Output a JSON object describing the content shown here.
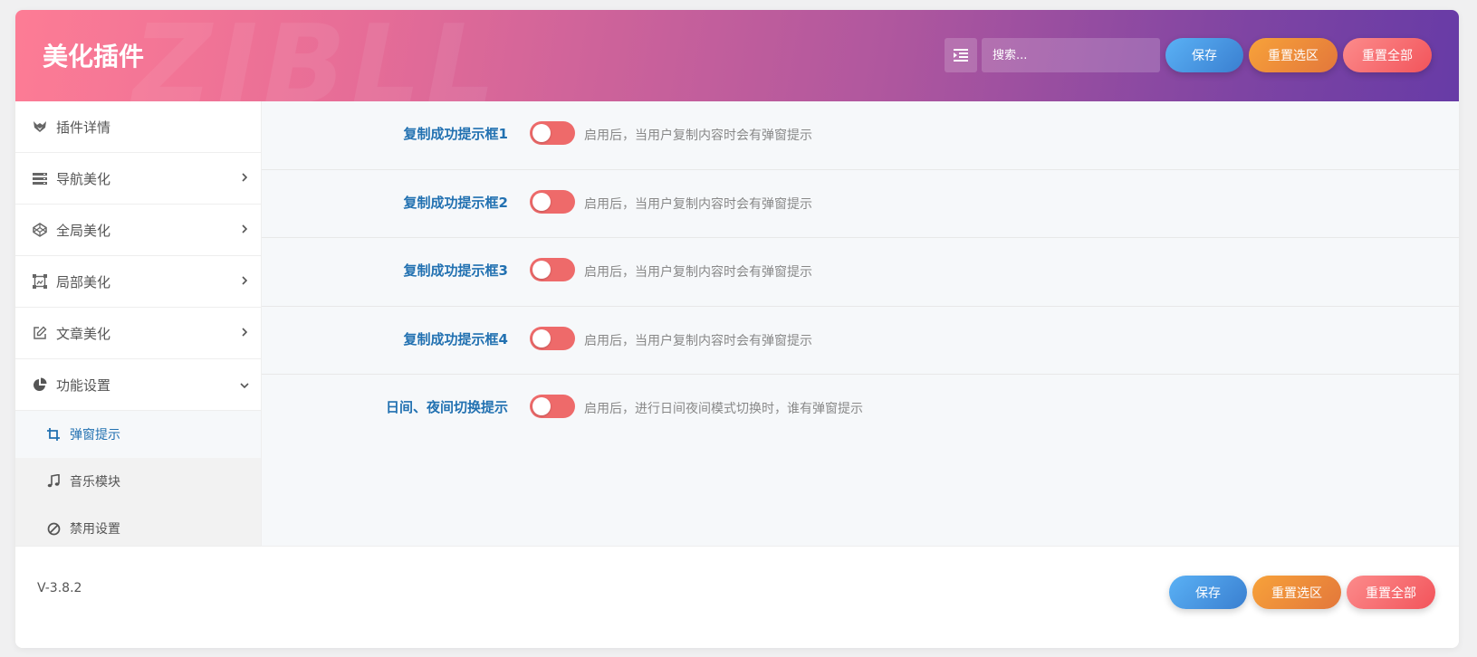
{
  "header": {
    "title": "美化插件",
    "watermark": "ZIBLL",
    "search_placeholder": "搜索...",
    "save_label": "保存",
    "reset_section_label": "重置选区",
    "reset_all_label": "重置全部"
  },
  "sidebar": {
    "items": [
      {
        "label": "插件详情",
        "icon": "fox-logo-icon"
      },
      {
        "label": "导航美化",
        "icon": "server-icon"
      },
      {
        "label": "全局美化",
        "icon": "codepen-icon"
      },
      {
        "label": "局部美化",
        "icon": "frame-icon"
      },
      {
        "label": "文章美化",
        "icon": "edit-icon"
      },
      {
        "label": "功能设置",
        "icon": "pie-chart-icon"
      }
    ],
    "sub_items": [
      {
        "label": "弹窗提示",
        "icon": "crop-icon",
        "active": true
      },
      {
        "label": "音乐模块",
        "icon": "music-icon"
      },
      {
        "label": "禁用设置",
        "icon": "ban-icon"
      }
    ]
  },
  "settings": [
    {
      "label": "复制成功提示框1",
      "desc": "启用后，当用户复制内容时会有弹窗提示",
      "enabled": false
    },
    {
      "label": "复制成功提示框2",
      "desc": "启用后，当用户复制内容时会有弹窗提示",
      "enabled": false
    },
    {
      "label": "复制成功提示框3",
      "desc": "启用后，当用户复制内容时会有弹窗提示",
      "enabled": false
    },
    {
      "label": "复制成功提示框4",
      "desc": "启用后，当用户复制内容时会有弹窗提示",
      "enabled": false
    },
    {
      "label": "日间、夜间切换提示",
      "desc": "启用后，进行日间夜间模式切换时，谁有弹窗提示",
      "enabled": false
    }
  ],
  "footer": {
    "version": "V-3.8.2",
    "save_label": "保存",
    "reset_section_label": "重置选区",
    "reset_all_label": "重置全部"
  },
  "colors": {
    "accent": "#2271b1",
    "toggle_off": "#ee6a6a",
    "header_start": "#fd7c95",
    "header_end": "#673ba6"
  }
}
